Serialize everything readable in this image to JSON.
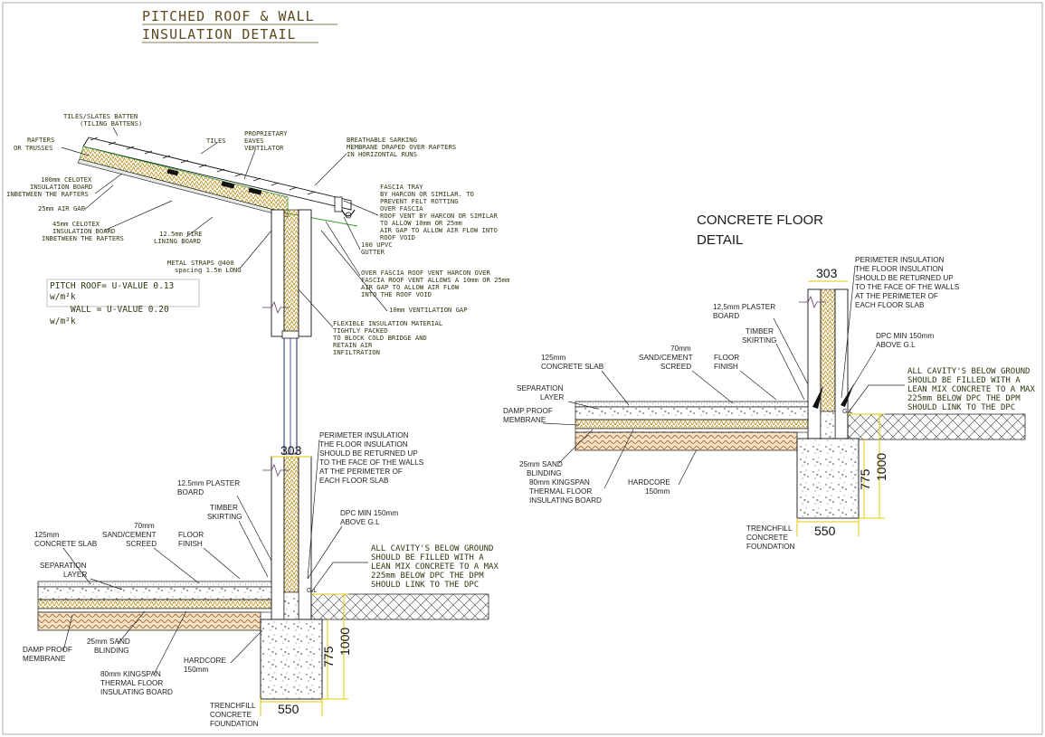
{
  "title": {
    "line1": "PITCHED ROOF & WALL",
    "line2": "INSULATION  DETAIL"
  },
  "concrete_title": {
    "line1": "CONCRETE FLOOR",
    "line2": "DETAIL"
  },
  "u_values": {
    "pitch": "PITCH ROOF= U-VALUE 0.13",
    "pitch_unit": "w/m²k",
    "wall": "WALL = U-VALUE 0.20",
    "wall_unit": "w/m²k"
  },
  "roof_labels": {
    "tiles_batten": "TILES/SLATES BATTEN",
    "tiling_battens": "(TILING BATTENS)",
    "tiles": "TILES",
    "rafters": "RAFTERS",
    "or_trusses": "OR TRUSSES",
    "celotex100_1": "100mm CELOTEX",
    "celotex100_2": "INSULATION BOARD",
    "celotex100_3": "INBETWEEN THE RAFTERS",
    "air_gap": "25mm AIR GAP",
    "celotex45_1": "45mm CELOTEX",
    "celotex45_2": "INSULATION BOARD",
    "celotex45_3": "INBETWEEN THE RAFTERS",
    "fire_1": "12.5mm FIRE",
    "fire_2": "LINING BOARD",
    "straps_1": "METAL STRAPS @400",
    "straps_2": "spacing 1.5m LONG",
    "eaves_1": "PROPRIETARY",
    "eaves_2": "EAVES",
    "eaves_3": "VENTILATOR",
    "sarking_1": "BREATHABLE SARKING",
    "sarking_2": "MEMBRANE DRAPED OVER RAFTERS",
    "sarking_3": "IN HORIZONTAL RUNS",
    "fascia_1": "FASCIA TRAY",
    "fascia_2": "BY HARCON OR SIMILAR. TO",
    "fascia_3": "PREVENT FELT ROTTING",
    "fascia_4": "OVER FASCIA",
    "fascia_5": "ROOF VENT BY HARCON OR SIMILAR",
    "fascia_6": "TO ALLOW 10mm OR 25mm",
    "fascia_7": "AIR GAP TO ALLOW AIR FLOW INTO",
    "fascia_8": "ROOF VOID",
    "gutter_1": "100 UPVC",
    "gutter_2": "GUTTER",
    "vent_1": "OVER FASCIA ROOF VENT HARCON OVER",
    "vent_2": "FASCIA ROOF VENT ALLOWS A 10mm OR 25mm",
    "vent_3": "AIR GAP TO ALLOW AIR FLOW",
    "vent_4": "INTO THE ROOF VOID",
    "vent_gap": "10mm VENTILATION GAP",
    "flex_1": "FLEXIBLE INSULATION MATERIAL",
    "flex_2": "TIGHTLY PACKED",
    "flex_3": "TO BLOCK COLD BRIDGE AND",
    "flex_4": "RETAIN AIR",
    "flex_5": "INFILTRATION"
  },
  "floor_labels": {
    "perimeter_1": "PERIMETER INSULATION",
    "perimeter_2": "THE FLOOR INSULATION",
    "perimeter_3": "SHOULD BE RETURNED UP",
    "perimeter_4": "TO THE FACE OF THE WALLS",
    "perimeter_5": "AT THE PERIMETER OF",
    "perimeter_6": "EACH FLOOR SLAB",
    "plaster_1": "12.5mm PLASTER",
    "plaster_2": "BOARD",
    "timber_1": "TIMBER",
    "timber_2": "SKIRTING",
    "dpc_1": "DPC MIN 150mm",
    "dpc_2": "ABOVE G.L",
    "screed_1": "70mm",
    "screed_2": "SAND/CEMENT",
    "screed_3": "SCREED",
    "finish_1": "FLOOR",
    "finish_2": "FINISH",
    "slab_1": "125mm",
    "slab_2": "CONCRETE SLAB",
    "sep_1": "SEPARATION",
    "sep_2": "LAYER",
    "dpm_1": "DAMP PROOF",
    "dpm_2": "MEMBRANE",
    "sand_1": "25mm SAND",
    "sand_2": "BLINDING",
    "king_1": "80mm KINGSPAN",
    "king_2": "THERMAL FLOOR",
    "king_3": "INSULATING BOARD",
    "hard_1": "HARDCORE",
    "hard_2": "150mm",
    "trench_1": "TRENCHFILL",
    "trench_2": "CONCRETE",
    "trench_3": "FOUNDATION",
    "cavity_1": "ALL CAVITY'S BELOW GROUND",
    "cavity_2": "SHOULD BE FILLED WITH A",
    "cavity_3": "LEAN MIX CONCRETE TO A MAX",
    "cavity_4": "225mm BELOW DPC THE DPM",
    "cavity_5": "SHOULD LINK TO THE DPC",
    "gl": "G.L"
  },
  "dimensions": {
    "wall": "303",
    "found_w": "550",
    "found_d1": "775",
    "found_d2": "1000"
  },
  "colors": {
    "insulation": "#f2e23a",
    "dim": "#e0c800",
    "green": "#2e9a2e",
    "hardcore": "#c88a4a"
  }
}
